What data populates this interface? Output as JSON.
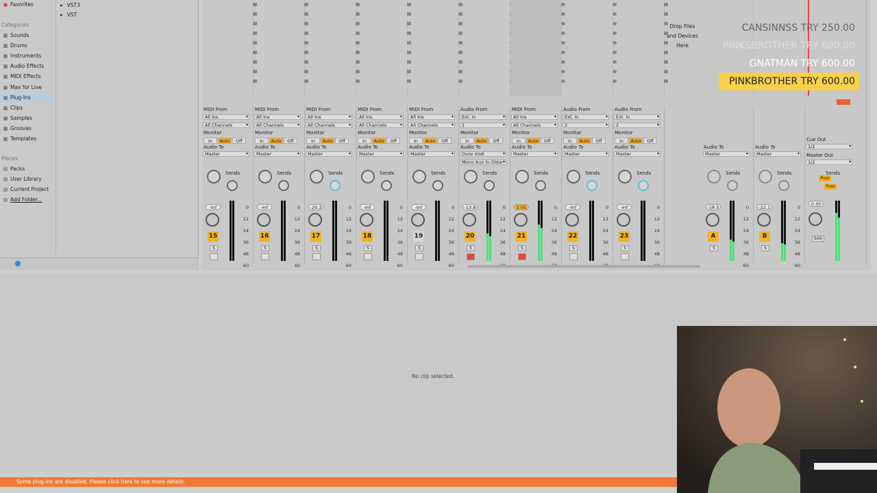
{
  "browser": {
    "favorites_label": "Favorites",
    "categories_header": "Categories",
    "categories": [
      {
        "label": "Sounds",
        "icon": "sounds-icon"
      },
      {
        "label": "Drums",
        "icon": "drums-icon"
      },
      {
        "label": "Instruments",
        "icon": "instruments-icon"
      },
      {
        "label": "Audio Effects",
        "icon": "audio-effects-icon"
      },
      {
        "label": "MIDI Effects",
        "icon": "midi-effects-icon"
      },
      {
        "label": "Max for Live",
        "icon": "max-icon"
      },
      {
        "label": "Plug-Ins",
        "icon": "plugins-icon"
      },
      {
        "label": "Clips",
        "icon": "clips-icon"
      },
      {
        "label": "Samples",
        "icon": "samples-icon"
      },
      {
        "label": "Grooves",
        "icon": "grooves-icon"
      },
      {
        "label": "Templates",
        "icon": "templates-icon"
      }
    ],
    "places_header": "Places",
    "places": [
      {
        "label": "Packs"
      },
      {
        "label": "User Library"
      },
      {
        "label": "Current Project"
      },
      {
        "label": "Add Folder..."
      }
    ],
    "plugin_folders": [
      "VST3",
      "VST"
    ]
  },
  "session": {
    "drop_text_1": "Drop Files",
    "drop_text_2": "and Devices",
    "drop_text_3": "Here"
  },
  "tracks": [
    {
      "from": "MIDI From",
      "input": "All Ins",
      "channel": "All Channels",
      "audio_to": "Audio To",
      "dest": "Master",
      "vol": "-Inf",
      "num": "15",
      "armed": false,
      "level": 0
    },
    {
      "from": "MIDI From",
      "input": "All Ins",
      "channel": "All Channels",
      "audio_to": "Audio To",
      "dest": "Master",
      "vol": "-Inf",
      "num": "16",
      "armed": false,
      "level": 0
    },
    {
      "from": "MIDI From",
      "input": "All Ins",
      "channel": "All Channels",
      "audio_to": "Audio To",
      "dest": "Master",
      "vol": "-20.3",
      "num": "17",
      "armed": false,
      "level": 0
    },
    {
      "from": "MIDI From",
      "input": "All Ins",
      "channel": "All Channels",
      "audio_to": "Audio To",
      "dest": "Master",
      "vol": "-Inf",
      "num": "18",
      "armed": false,
      "level": 0
    },
    {
      "from": "MIDI From",
      "input": "All Ins",
      "channel": "All Channels",
      "audio_to": "Audio To",
      "dest": "Master",
      "vol": "-Inf",
      "num": "19",
      "armed": false,
      "level": 0,
      "off": true
    },
    {
      "from": "Audio From",
      "input": "Ext. In",
      "channel": "1",
      "audio_to": "Audio To",
      "dest": "Ovox midi",
      "extra": "Mono Aux In-OVox",
      "vol": "-13.8",
      "num": "20",
      "armed": true,
      "level": 0.45
    },
    {
      "from": "MIDI From",
      "input": "All Ins",
      "channel": "All Channels",
      "audio_to": "Audio To",
      "dest": "Master",
      "vol": "2.05",
      "num": "21",
      "armed": true,
      "level": 0.6,
      "hot": true
    },
    {
      "from": "Audio From",
      "input": "Ext. In",
      "channel": "2",
      "audio_to": "Audio To",
      "dest": "Master",
      "vol": "-Inf",
      "num": "22",
      "armed": false,
      "level": 0
    },
    {
      "from": "Audio From",
      "input": "Ext. In",
      "channel": "2",
      "audio_to": "Audio To",
      "dest": "Master",
      "vol": "-Inf",
      "num": "23",
      "armed": false,
      "level": 0
    }
  ],
  "returns": [
    {
      "audio_to": "Audio To",
      "dest": "Master",
      "vol": "-18.5",
      "num": "A",
      "level": 0.35
    },
    {
      "audio_to": "Audio To",
      "dest": "Master",
      "vol": "-22.1",
      "num": "B",
      "level": 0.3
    }
  ],
  "master": {
    "cue_out_label": "Cue Out",
    "cue_out": "1/2",
    "master_out_label": "Master Out",
    "master_out": "1/2",
    "vol": "0.30",
    "solo": "Solo",
    "post": "Post",
    "level": 0.8
  },
  "sends_label": "Sends",
  "monitor_label": "Monitor",
  "monitor": {
    "in": "In",
    "auto": "Auto",
    "off": "Off"
  },
  "meter_scale": [
    "0",
    "12",
    "24",
    "36",
    "48",
    "60"
  ],
  "overlay": [
    {
      "name": "CANSINNSS",
      "amount": "TRY 250.00",
      "style": "faded"
    },
    {
      "name": "PINKSBROTHER",
      "amount": "TRY 600.00",
      "style": "ghost"
    },
    {
      "name": "GNATMAN",
      "amount": "TRY 600.00",
      "style": "white"
    },
    {
      "name": "PINKBROTHER",
      "amount": "TRY 600.00",
      "style": "highlight"
    }
  ],
  "detail": {
    "no_clip": "No clip selected."
  },
  "status": {
    "message": "Some plug-ins are disabled. Please click here to see more details."
  },
  "colors": {
    "accent": "#f3b223",
    "arm": "#e4463d",
    "meter": "#4de07d",
    "status": "#f07a35"
  }
}
